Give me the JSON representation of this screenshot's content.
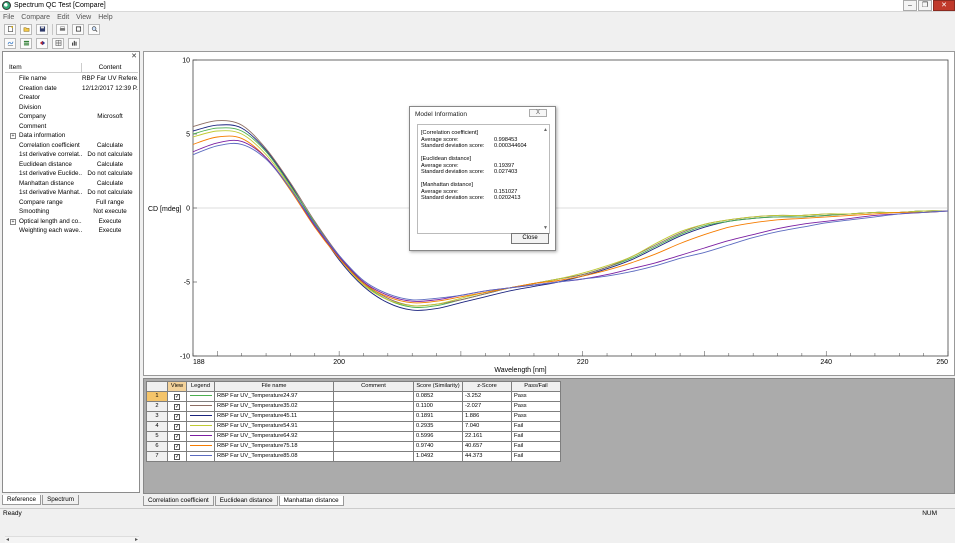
{
  "window": {
    "title": "Spectrum QC Test [Compare]"
  },
  "menu": [
    "File",
    "Compare",
    "Edit",
    "View",
    "Help"
  ],
  "toolbar1": [
    "new-icon",
    "open-icon",
    "save-icon",
    "print-icon",
    "refresh-icon",
    "find-icon"
  ],
  "toolbar2": [
    "overlay-icon",
    "spectrum-icon",
    "compare-icon",
    "table-icon",
    "bars-icon"
  ],
  "properties": {
    "header": {
      "item": "Item",
      "content": "Content"
    },
    "rows": [
      {
        "key": "File name",
        "value": "RBP Far UV Refere..."
      },
      {
        "key": "Creation date",
        "value": "12/12/2017 12:39 P..."
      },
      {
        "key": "Creator",
        "value": ""
      },
      {
        "key": "Division",
        "value": ""
      },
      {
        "key": "Company",
        "value": "Microsoft"
      },
      {
        "key": "Comment",
        "value": ""
      },
      {
        "key": "Data information",
        "value": "",
        "expand": true
      },
      {
        "key": "Correlation coefficient",
        "value": "Calculate"
      },
      {
        "key": "1st derivative correlat...",
        "value": "Do not calculate"
      },
      {
        "key": "Euclidean distance",
        "value": "Calculate"
      },
      {
        "key": "1st derivative Euclide...",
        "value": "Do not calculate"
      },
      {
        "key": "Manhattan distance",
        "value": "Calculate"
      },
      {
        "key": "1st derivative Manhat...",
        "value": "Do not calculate"
      },
      {
        "key": "Compare range",
        "value": "Full range"
      },
      {
        "key": "Smoothing",
        "value": "Not execute"
      },
      {
        "key": "Optical length and co...",
        "value": "Execute",
        "expand": true
      },
      {
        "key": "Weighting each wave...",
        "value": "Execute"
      }
    ]
  },
  "left_tabs": [
    "Reference",
    "Spectrum"
  ],
  "chart_data": {
    "type": "line",
    "xlabel": "Wavelength [nm]",
    "ylabel": "CD [mdeg]",
    "xlim": [
      188,
      250
    ],
    "ylim": [
      -10,
      10
    ],
    "xticks": [
      188,
      200,
      220,
      240,
      250
    ],
    "yticks": [
      10,
      5,
      0,
      -5,
      -10
    ],
    "grid": false,
    "series": [
      {
        "color": "#1a237e",
        "x": [
          188,
          190,
          192,
          194,
          196,
          198,
          200,
          202,
          204,
          206,
          208,
          210,
          212,
          214,
          216,
          218,
          220,
          222,
          224,
          226,
          228,
          230,
          232,
          234,
          236,
          238,
          240,
          242,
          244,
          246,
          248,
          250
        ],
        "values": [
          5.2,
          5.6,
          5.4,
          3.9,
          1.6,
          -1.1,
          -3.5,
          -5.3,
          -6.4,
          -6.9,
          -6.8,
          -6.4,
          -6.0,
          -5.6,
          -5.3,
          -5.0,
          -4.6,
          -4.1,
          -3.5,
          -2.7,
          -1.9,
          -1.3,
          -0.9,
          -0.7,
          -0.6,
          -0.6,
          -0.5,
          -0.4,
          -0.3,
          -0.3,
          -0.2,
          -0.2
        ]
      },
      {
        "color": "#4caf50",
        "x": [
          188,
          190,
          192,
          194,
          196,
          198,
          200,
          202,
          204,
          206,
          208,
          210,
          212,
          214,
          216,
          218,
          220,
          222,
          224,
          226,
          228,
          230,
          232,
          234,
          236,
          238,
          240,
          242,
          244,
          246,
          248,
          250
        ],
        "values": [
          5.0,
          5.4,
          5.2,
          3.8,
          1.5,
          -1.0,
          -3.3,
          -5.1,
          -6.2,
          -6.7,
          -6.6,
          -6.2,
          -5.8,
          -5.4,
          -5.1,
          -4.8,
          -4.5,
          -4.0,
          -3.4,
          -2.6,
          -1.8,
          -1.2,
          -0.9,
          -0.7,
          -0.6,
          -0.6,
          -0.5,
          -0.4,
          -0.3,
          -0.3,
          -0.2,
          -0.2
        ]
      },
      {
        "color": "#8d6e63",
        "x": [
          188,
          190,
          192,
          194,
          196,
          198,
          200,
          202,
          204,
          206,
          208,
          210,
          212,
          214,
          216,
          218,
          220,
          222,
          224,
          226,
          228,
          230,
          232,
          234,
          236,
          238,
          240,
          242,
          244,
          246,
          248,
          250
        ],
        "values": [
          5.5,
          5.9,
          5.6,
          4.0,
          1.7,
          -0.9,
          -3.2,
          -5.0,
          -6.1,
          -6.6,
          -6.5,
          -6.2,
          -5.8,
          -5.4,
          -5.1,
          -4.8,
          -4.5,
          -4.0,
          -3.3,
          -2.5,
          -1.7,
          -1.1,
          -0.8,
          -0.6,
          -0.5,
          -0.5,
          -0.4,
          -0.4,
          -0.3,
          -0.3,
          -0.2,
          -0.2
        ]
      },
      {
        "color": "#c0ca33",
        "x": [
          188,
          190,
          192,
          194,
          196,
          198,
          200,
          202,
          204,
          206,
          208,
          210,
          212,
          214,
          216,
          218,
          220,
          222,
          224,
          226,
          228,
          230,
          232,
          234,
          236,
          238,
          240,
          242,
          244,
          246,
          248,
          250
        ],
        "values": [
          4.8,
          5.2,
          5.0,
          3.6,
          1.4,
          -1.2,
          -3.4,
          -5.2,
          -6.2,
          -6.6,
          -6.5,
          -6.1,
          -5.7,
          -5.4,
          -5.1,
          -4.8,
          -4.4,
          -3.9,
          -3.3,
          -2.4,
          -1.6,
          -1.1,
          -0.8,
          -0.6,
          -0.5,
          -0.5,
          -0.4,
          -0.4,
          -0.3,
          -0.3,
          -0.2,
          -0.2
        ]
      },
      {
        "color": "#f57c00",
        "x": [
          188,
          190,
          192,
          194,
          196,
          198,
          200,
          202,
          204,
          206,
          208,
          210,
          212,
          214,
          216,
          218,
          220,
          222,
          224,
          226,
          228,
          230,
          232,
          234,
          236,
          238,
          240,
          242,
          244,
          246,
          248,
          250
        ],
        "values": [
          4.3,
          4.8,
          4.7,
          3.4,
          1.2,
          -1.3,
          -3.4,
          -5.1,
          -6.0,
          -6.4,
          -6.3,
          -6.0,
          -5.7,
          -5.4,
          -5.1,
          -4.9,
          -4.6,
          -4.2,
          -3.7,
          -3.1,
          -2.4,
          -1.8,
          -1.3,
          -1.0,
          -0.8,
          -0.7,
          -0.6,
          -0.5,
          -0.4,
          -0.3,
          -0.3,
          -0.2
        ]
      },
      {
        "color": "#7b1fa2",
        "x": [
          188,
          190,
          192,
          194,
          196,
          198,
          200,
          202,
          204,
          206,
          208,
          210,
          212,
          214,
          216,
          218,
          220,
          222,
          224,
          226,
          228,
          230,
          232,
          234,
          236,
          238,
          240,
          242,
          244,
          246,
          248,
          250
        ],
        "values": [
          3.8,
          4.4,
          4.5,
          3.4,
          1.3,
          -1.2,
          -3.3,
          -5.0,
          -5.9,
          -6.3,
          -6.2,
          -5.9,
          -5.6,
          -5.4,
          -5.2,
          -5.0,
          -4.8,
          -4.5,
          -4.1,
          -3.7,
          -3.2,
          -2.7,
          -2.2,
          -1.8,
          -1.4,
          -1.1,
          -0.9,
          -0.7,
          -0.5,
          -0.4,
          -0.3,
          -0.2
        ]
      },
      {
        "color": "#5c6bc0",
        "x": [
          188,
          190,
          192,
          194,
          196,
          198,
          200,
          202,
          204,
          206,
          208,
          210,
          212,
          214,
          216,
          218,
          220,
          222,
          224,
          226,
          228,
          230,
          232,
          234,
          236,
          238,
          240,
          242,
          244,
          246,
          248,
          250
        ],
        "values": [
          3.6,
          4.2,
          4.3,
          3.3,
          1.3,
          -1.1,
          -3.2,
          -4.9,
          -5.8,
          -6.2,
          -6.1,
          -5.9,
          -5.6,
          -5.4,
          -5.2,
          -5.0,
          -4.8,
          -4.6,
          -4.3,
          -3.9,
          -3.4,
          -3.0,
          -2.5,
          -2.0,
          -1.6,
          -1.3,
          -1.0,
          -0.8,
          -0.6,
          -0.4,
          -0.3,
          -0.2
        ]
      }
    ]
  },
  "dialog": {
    "title": "Model Information",
    "close_x": "X",
    "sections": [
      {
        "name": "[Correlation coefficient]",
        "avg_label": "Average score:",
        "avg": "0.998453",
        "sd_label": "Standard deviation score:",
        "sd": "0.000344604"
      },
      {
        "name": "[Euclidean distance]",
        "avg_label": "Average score:",
        "avg": "0.19397",
        "sd_label": "Standard deviation score:",
        "sd": "0.027403"
      },
      {
        "name": "[Manhattan distance]",
        "avg_label": "Average score:",
        "avg": "0.151027",
        "sd_label": "Standard deviation score:",
        "sd": "0.0202413"
      }
    ],
    "close_button": "Close"
  },
  "table": {
    "columns": [
      "",
      "View",
      "Legend",
      "File name",
      "Comment",
      "Score (Similarity)",
      "z-Score",
      "Pass/Fail"
    ],
    "rows": [
      {
        "n": "1",
        "color": "#4caf50",
        "file": "RBP Far UV_Temperature24.97",
        "comment": "",
        "score": "0.0852",
        "z": "-3.252",
        "pf": "Pass"
      },
      {
        "n": "2",
        "color": "#8d6e63",
        "file": "RBP Far UV_Temperature35.02",
        "comment": "",
        "score": "0.1100",
        "z": "-2.027",
        "pf": "Pass"
      },
      {
        "n": "3",
        "color": "#1a237e",
        "file": "RBP Far UV_Temperature45.11",
        "comment": "",
        "score": "0.1891",
        "z": "1.886",
        "pf": "Pass"
      },
      {
        "n": "4",
        "color": "#c0ca33",
        "file": "RBP Far UV_Temperature54.91",
        "comment": "",
        "score": "0.2935",
        "z": "7.040",
        "pf": "Fail"
      },
      {
        "n": "5",
        "color": "#7b1fa2",
        "file": "RBP Far UV_Temperature64.92",
        "comment": "",
        "score": "0.5996",
        "z": "22.161",
        "pf": "Fail"
      },
      {
        "n": "6",
        "color": "#f57c00",
        "file": "RBP Far UV_Temperature75.18",
        "comment": "",
        "score": "0.9740",
        "z": "40.657",
        "pf": "Fail"
      },
      {
        "n": "7",
        "color": "#5c6bc0",
        "file": "RBP Far UV_Temperature85.08",
        "comment": "",
        "score": "1.0492",
        "z": "44.373",
        "pf": "Fail"
      }
    ]
  },
  "bottom_tabs": [
    "Correlation coefficient",
    "Euclidean distance",
    "Manhattan distance"
  ],
  "status": {
    "left": "Ready",
    "right": "NUM"
  }
}
